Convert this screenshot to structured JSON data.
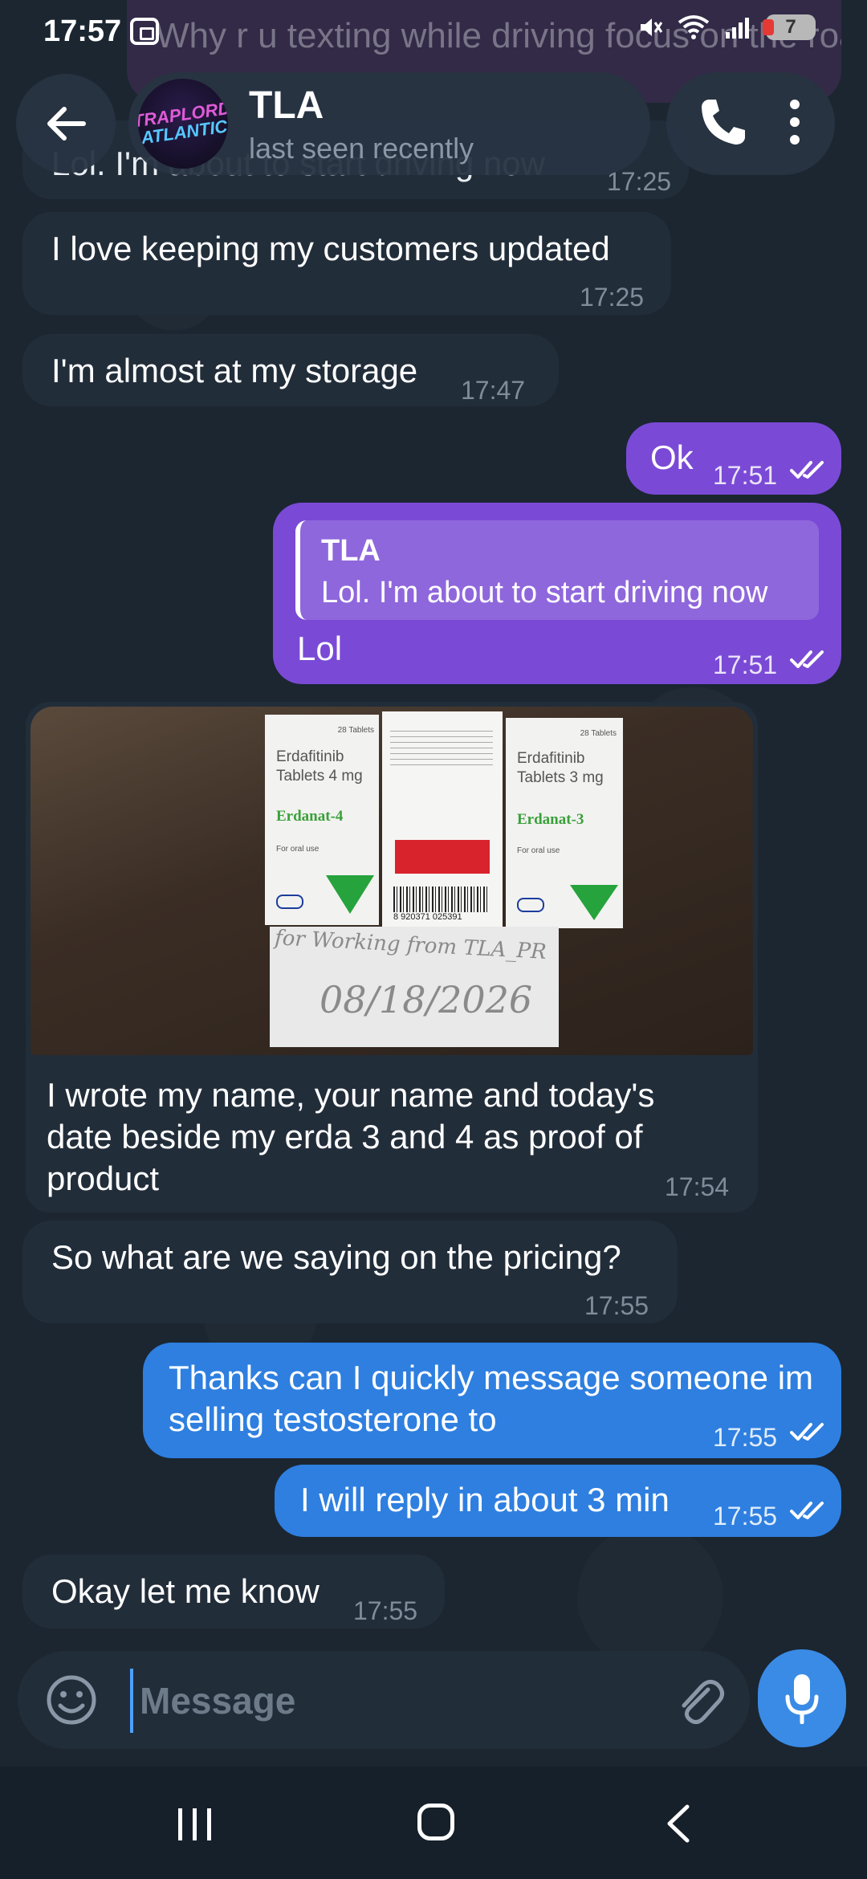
{
  "status": {
    "time": "17:57",
    "notification_preview": "Why r u texting while driving focus on the road",
    "battery": "7"
  },
  "header": {
    "avatar_line1": "TRAPLORD",
    "avatar_line2": "ATLANTIC",
    "contact_name": "TLA",
    "contact_status": "last seen recently"
  },
  "messages": {
    "m0": {
      "text": "Lol. I'm about to start driving now",
      "time": "17:25"
    },
    "m1": {
      "text": "I love keeping my customers updated",
      "time": "17:25"
    },
    "m2": {
      "text": "I'm almost at my storage",
      "time": "17:47"
    },
    "m3": {
      "text": "Ok",
      "time": "17:51"
    },
    "m4": {
      "reply_name": "TLA",
      "reply_text": "Lol. I'm about to start driving now",
      "text": "Lol",
      "time": "17:51"
    },
    "m5": {
      "text": "I wrote my name, your name and today's date beside my erda 3 and 4 as proof of product",
      "time": "17:54",
      "photo": {
        "box1_line1": "Erdafitinib",
        "box1_line2": "Tablets 4 mg",
        "box1_brand": "Erdanat-4",
        "box1_count": "28 Tablets",
        "box2_line1": "Erdafitinib",
        "box2_line2": "Tablets 3 mg",
        "box2_brand": "Erdanat-3",
        "box2_count": "28 Tablets",
        "oral": "For oral use",
        "barcode": "8 920371 025391",
        "note_line1": "for Working from TLA_PR",
        "note_line2": "08/18/2026"
      }
    },
    "m6": {
      "text": "So what are we saying on the pricing?",
      "time": "17:55"
    },
    "m7": {
      "text": "Thanks can I quickly message someone im selling testosterone to",
      "time": "17:55"
    },
    "m8": {
      "text": "I will reply in about 3 min",
      "time": "17:55"
    },
    "m9": {
      "text": "Okay let me know",
      "time": "17:55"
    }
  },
  "composer": {
    "placeholder": "Message"
  },
  "colors": {
    "incoming": "#222d3a",
    "outgoing_purple": "#7a4ad6",
    "outgoing_blue": "#2e7fe0",
    "background": "#1b2631"
  }
}
